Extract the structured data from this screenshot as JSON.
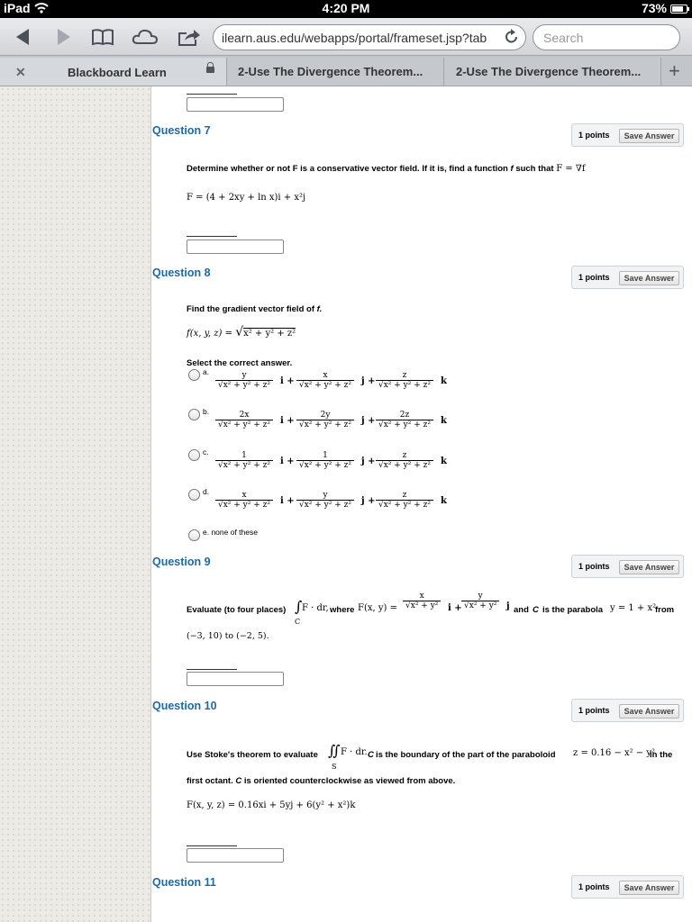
{
  "status": {
    "device": "iPad",
    "time": "4:20 PM",
    "battery": "73%"
  },
  "browser": {
    "url_main": "ilearn.aus.edu/webapps/portal/frameset.jsp?tab",
    "url_fade": "",
    "search_placeholder": "Search"
  },
  "tabs": {
    "active": "Blackboard Learn",
    "tab2": "2-Use The Divergence Theorem...",
    "tab3": "2-Use The Divergence Theorem..."
  },
  "icons": [
    "back-icon",
    "forward-icon",
    "bookmarks-icon",
    "icloud-icon",
    "share-icon",
    "reload-icon",
    "close-tab-icon",
    "lock-icon",
    "new-tab-icon",
    "wifi-icon",
    "battery-icon",
    "radio-button-icon"
  ],
  "common": {
    "points": "1 points",
    "save": "Save Answer"
  },
  "q7": {
    "head": "Question 7",
    "text": "Determine whether or not F is a conservative vector field. If it is, find a function",
    "f": "f",
    "such": "such that",
    "rhs": "F = ∇f",
    "Feq": "F = ",
    "F_body": "(4 + 2xy + ln x)i + x²j"
  },
  "q8": {
    "head": "Question 8",
    "text": "Find the gradient vector field of",
    "f": "f.",
    "func": "f(x, y, z) = ",
    "rad": "x² + y² + z²",
    "select": "Select the correct answer.",
    "options": [
      {
        "label": "a.",
        "num": [
          "y",
          "x",
          "z"
        ]
      },
      {
        "label": "b.",
        "num": [
          "2x",
          "2y",
          "2z"
        ]
      },
      {
        "label": "c.",
        "num": [
          "1",
          "1",
          "z"
        ]
      },
      {
        "label": "d.",
        "num": [
          "x",
          "y",
          "z"
        ]
      },
      {
        "label": "e. none of these"
      }
    ],
    "den": "x² + y² + z²",
    "units": [
      "i +",
      "j +",
      "k"
    ]
  },
  "q9": {
    "head": "Question 9",
    "pre": "Evaluate (to four places)",
    "int": "∫",
    "sub": "C",
    "Fdr": "F · dr,",
    "where": "where",
    "Fxy": "F(x, y) = ",
    "num1": "x",
    "num2": "y",
    "den": "x² + y²",
    "i": "i +",
    "j": "j",
    "and": "and",
    "C": "C",
    "isparab": "is the parabola",
    "parab": "y = 1 + x²",
    "from": "from",
    "pts": "(−3, 10)  to  (−2, 5)."
  },
  "q10": {
    "head": "Question 10",
    "pre": "Use Stoke's theorem to evaluate",
    "int": "∬",
    "sub": "S",
    "Fdr": "F · dr.",
    "C": "C",
    "mid": "is the boundary of the part of the paraboloid",
    "parab": "z = 0.16 − x² − y²",
    "inthe": "in the",
    "line2a": "first octant.",
    "line2b": "C",
    "line2c": "is oriented counterclockwise as viewed from above.",
    "F": "F(x, y, z) = 0.16xi + 5yj + 6(y² + x²)k"
  },
  "q11": {
    "head": "Question 11"
  }
}
